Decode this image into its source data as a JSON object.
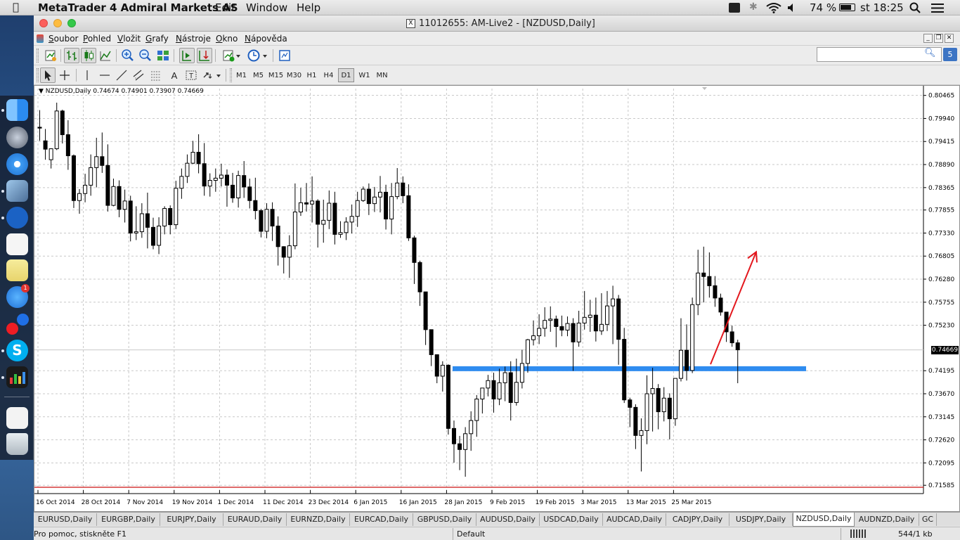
{
  "menubar": {
    "app_name": "MetaTrader 4 Admiral Markets AS",
    "items": [
      "Edit",
      "Window",
      "Help"
    ],
    "battery_text": "74 %",
    "clock": "st 18:25"
  },
  "window": {
    "title": "11012655: AM-Live2 - [NZDUSD,Daily]",
    "menu": [
      "Soubor",
      "Pohled",
      "Vložit",
      "Grafy",
      "Nástroje",
      "Okno",
      "Nápověda"
    ],
    "search_badge": "5"
  },
  "toolbar": {
    "timeframes": [
      "M1",
      "M5",
      "M15",
      "M30",
      "H1",
      "H4",
      "D1",
      "W1",
      "MN"
    ],
    "active_timeframe": "D1"
  },
  "chart_data": {
    "type": "candlestick",
    "symbol_label": "NZDUSD,Daily",
    "ohlc_text": "0.74674 0.74901 0.73907 0.74669",
    "current_price": "0.74669",
    "y_ticks": [
      "0.80465",
      "0.79940",
      "0.79415",
      "0.78890",
      "0.78365",
      "0.77855",
      "0.77330",
      "0.76805",
      "0.76280",
      "0.75755",
      "0.75230",
      "0.74195",
      "0.73670",
      "0.73145",
      "0.72620",
      "0.72095",
      "0.71585"
    ],
    "ylim": [
      0.7154,
      0.8062
    ],
    "x_labels": [
      "16 Oct 2014",
      "28 Oct 2014",
      "7 Nov 2014",
      "19 Nov 2014",
      "1 Dec 2014",
      "11 Dec 2014",
      "23 Dec 2014",
      "6 Jan 2015",
      "16 Jan 2015",
      "28 Jan 2015",
      "9 Feb 2015",
      "19 Feb 2015",
      "3 Mar 2015",
      "13 Mar 2015",
      "25 Mar 2015"
    ],
    "support_level": 0.7424,
    "support_range": [
      "28 Jan 2015",
      "15 Apr 2015"
    ],
    "arrow": {
      "from": [
        0.7434,
        "31 Mar 2015"
      ],
      "to": [
        0.769,
        "6 Apr 2015"
      ]
    },
    "colors": {
      "support": "#2f8cf0",
      "arrow": "#e3171d",
      "bottom_line": "#cc1111"
    },
    "grid": true,
    "candles": [
      [
        0.7974,
        0.8013,
        0.7972,
        0.7943
      ],
      [
        0.7943,
        0.797,
        0.7924,
        0.79
      ],
      [
        0.79,
        0.7926,
        0.7925,
        0.788
      ],
      [
        0.7925,
        0.803,
        0.8011,
        0.7922
      ],
      [
        0.8011,
        0.8014,
        0.7957,
        0.7937
      ],
      [
        0.7957,
        0.799,
        0.7909,
        0.7877
      ],
      [
        0.7909,
        0.7912,
        0.7807,
        0.779
      ],
      [
        0.7807,
        0.7833,
        0.7823,
        0.7777
      ],
      [
        0.7823,
        0.7868,
        0.7842,
        0.7803
      ],
      [
        0.7842,
        0.7912,
        0.7882,
        0.7818
      ],
      [
        0.7882,
        0.795,
        0.7907,
        0.7837
      ],
      [
        0.7907,
        0.7962,
        0.7887,
        0.787
      ],
      [
        0.7887,
        0.7935,
        0.7796,
        0.7782
      ],
      [
        0.7796,
        0.7857,
        0.7839,
        0.7794
      ],
      [
        0.7839,
        0.7853,
        0.7787,
        0.7769
      ],
      [
        0.7787,
        0.7832,
        0.7806,
        0.7757
      ],
      [
        0.7806,
        0.7818,
        0.7733,
        0.7714
      ],
      [
        0.7733,
        0.7794,
        0.7736,
        0.7717
      ],
      [
        0.7736,
        0.7801,
        0.7777,
        0.7722
      ],
      [
        0.7777,
        0.7825,
        0.7746,
        0.7698
      ],
      [
        0.7746,
        0.7768,
        0.7705,
        0.7696
      ],
      [
        0.7705,
        0.7769,
        0.7749,
        0.7685
      ],
      [
        0.7749,
        0.7794,
        0.7789,
        0.773
      ],
      [
        0.7789,
        0.7796,
        0.7752,
        0.773
      ],
      [
        0.7752,
        0.7852,
        0.7835,
        0.7742
      ],
      [
        0.7835,
        0.788,
        0.7862,
        0.7811
      ],
      [
        0.7862,
        0.7912,
        0.7892,
        0.7847
      ],
      [
        0.7892,
        0.7943,
        0.7917,
        0.789
      ],
      [
        0.7917,
        0.7958,
        0.7891,
        0.7869
      ],
      [
        0.7891,
        0.7938,
        0.784,
        0.7818
      ],
      [
        0.784,
        0.7869,
        0.7853,
        0.7816
      ],
      [
        0.7853,
        0.788,
        0.7858,
        0.7827
      ],
      [
        0.7858,
        0.7891,
        0.7865,
        0.7839
      ],
      [
        0.7865,
        0.7878,
        0.7842,
        0.7793
      ],
      [
        0.7842,
        0.787,
        0.7813,
        0.7802
      ],
      [
        0.7813,
        0.7875,
        0.7864,
        0.7791
      ],
      [
        0.7864,
        0.7897,
        0.7838,
        0.7813
      ],
      [
        0.7838,
        0.7857,
        0.7807,
        0.7789
      ],
      [
        0.7807,
        0.7859,
        0.7784,
        0.7764
      ],
      [
        0.7784,
        0.7788,
        0.7737,
        0.7723
      ],
      [
        0.7737,
        0.7801,
        0.7787,
        0.7721
      ],
      [
        0.7787,
        0.7803,
        0.7749,
        0.7715
      ],
      [
        0.7749,
        0.7771,
        0.7702,
        0.7659
      ],
      [
        0.7702,
        0.7703,
        0.7678,
        0.7641
      ],
      [
        0.7678,
        0.7728,
        0.7704,
        0.7631
      ],
      [
        0.7704,
        0.7846,
        0.7781,
        0.7696
      ],
      [
        0.7781,
        0.7836,
        0.7802,
        0.7772
      ],
      [
        0.7802,
        0.7847,
        0.7799,
        0.7782
      ],
      [
        0.7799,
        0.7862,
        0.7806,
        0.7757
      ],
      [
        0.7806,
        0.781,
        0.7753,
        0.77
      ],
      [
        0.7753,
        0.7809,
        0.7762,
        0.7711
      ],
      [
        0.7762,
        0.783,
        0.7801,
        0.7742
      ],
      [
        0.7801,
        0.7827,
        0.773,
        0.7707
      ],
      [
        0.773,
        0.776,
        0.7734,
        0.7722
      ],
      [
        0.7734,
        0.7769,
        0.7758,
        0.7717
      ],
      [
        0.7758,
        0.7798,
        0.7771,
        0.7732
      ],
      [
        0.7771,
        0.7827,
        0.7807,
        0.7747
      ],
      [
        0.7807,
        0.7839,
        0.7833,
        0.7804
      ],
      [
        0.7833,
        0.7846,
        0.78,
        0.7774
      ],
      [
        0.78,
        0.7838,
        0.7815,
        0.7781
      ],
      [
        0.7815,
        0.7863,
        0.7826,
        0.778
      ],
      [
        0.7826,
        0.7843,
        0.7765,
        0.7741
      ],
      [
        0.7765,
        0.7847,
        0.7816,
        0.773
      ],
      [
        0.7816,
        0.7881,
        0.7847,
        0.781
      ],
      [
        0.7847,
        0.7862,
        0.7818,
        0.7801
      ],
      [
        0.7818,
        0.7844,
        0.7722,
        0.7715
      ],
      [
        0.7722,
        0.7727,
        0.7666,
        0.7617
      ],
      [
        0.7666,
        0.767,
        0.7599,
        0.7567
      ],
      [
        0.7599,
        0.7591,
        0.7513,
        0.7478
      ],
      [
        0.7513,
        0.7477,
        0.7456,
        0.743
      ],
      [
        0.7456,
        0.7428,
        0.7407,
        0.7391
      ],
      [
        0.7407,
        0.7441,
        0.7432,
        0.7372
      ],
      [
        0.7432,
        0.7434,
        0.7288,
        0.7274
      ],
      [
        0.7288,
        0.7306,
        0.7253,
        0.721
      ],
      [
        0.7253,
        0.7271,
        0.724,
        0.7193
      ],
      [
        0.724,
        0.7291,
        0.7276,
        0.7178
      ],
      [
        0.7276,
        0.7327,
        0.7306,
        0.7237
      ],
      [
        0.7306,
        0.7364,
        0.7355,
        0.7269
      ],
      [
        0.7355,
        0.7376,
        0.738,
        0.7322
      ],
      [
        0.738,
        0.741,
        0.7397,
        0.7361
      ],
      [
        0.7397,
        0.7415,
        0.7355,
        0.7324
      ],
      [
        0.7355,
        0.7424,
        0.7392,
        0.7341
      ],
      [
        0.7392,
        0.7429,
        0.7415,
        0.735
      ],
      [
        0.7415,
        0.7441,
        0.7347,
        0.7306
      ],
      [
        0.7347,
        0.7447,
        0.7393,
        0.734
      ],
      [
        0.7393,
        0.7467,
        0.7436,
        0.7379
      ],
      [
        0.7436,
        0.7492,
        0.749,
        0.7415
      ],
      [
        0.749,
        0.7534,
        0.7499,
        0.7477
      ],
      [
        0.7499,
        0.7548,
        0.7516,
        0.748
      ],
      [
        0.7516,
        0.7564,
        0.7534,
        0.7497
      ],
      [
        0.7534,
        0.7566,
        0.7537,
        0.7508
      ],
      [
        0.7537,
        0.7545,
        0.752,
        0.7473
      ],
      [
        0.752,
        0.7545,
        0.7512,
        0.7498
      ],
      [
        0.7512,
        0.7543,
        0.7527,
        0.7498
      ],
      [
        0.7527,
        0.7539,
        0.7485,
        0.7419
      ],
      [
        0.7485,
        0.7556,
        0.7528,
        0.7474
      ],
      [
        0.7528,
        0.7601,
        0.7541,
        0.7513
      ],
      [
        0.7541,
        0.7581,
        0.7546,
        0.7508
      ],
      [
        0.7546,
        0.7586,
        0.751,
        0.7486
      ],
      [
        0.751,
        0.7596,
        0.7525,
        0.7501
      ],
      [
        0.7525,
        0.7601,
        0.7567,
        0.751
      ],
      [
        0.7567,
        0.7613,
        0.7583,
        0.748
      ],
      [
        0.7583,
        0.7592,
        0.7491,
        0.7433
      ],
      [
        0.7491,
        0.7517,
        0.7353,
        0.7346
      ],
      [
        0.7353,
        0.7358,
        0.7336,
        0.7291
      ],
      [
        0.7336,
        0.7343,
        0.7272,
        0.7241
      ],
      [
        0.7272,
        0.7311,
        0.7283,
        0.719
      ],
      [
        0.7283,
        0.7409,
        0.7367,
        0.7252
      ],
      [
        0.7367,
        0.7426,
        0.7379,
        0.7281
      ],
      [
        0.7379,
        0.7389,
        0.7326,
        0.7286
      ],
      [
        0.7326,
        0.7382,
        0.7357,
        0.7304
      ],
      [
        0.7357,
        0.7368,
        0.731,
        0.7263
      ],
      [
        0.731,
        0.7401,
        0.7402,
        0.7294
      ],
      [
        0.7402,
        0.7539,
        0.7466,
        0.7395
      ],
      [
        0.7466,
        0.7525,
        0.742,
        0.7397
      ],
      [
        0.742,
        0.7586,
        0.757,
        0.7414
      ],
      [
        0.757,
        0.7695,
        0.7642,
        0.7546
      ],
      [
        0.7642,
        0.7702,
        0.7634,
        0.7575
      ],
      [
        0.7634,
        0.7689,
        0.7613,
        0.7586
      ],
      [
        0.7613,
        0.7635,
        0.7585,
        0.7565
      ],
      [
        0.7585,
        0.7595,
        0.7553,
        0.7545
      ],
      [
        0.7553,
        0.7552,
        0.7508,
        0.7485
      ],
      [
        0.7508,
        0.7522,
        0.7483,
        0.7474
      ],
      [
        0.7483,
        0.749,
        0.7467,
        0.7391
      ]
    ]
  },
  "tabs": [
    "EURUSD,Daily",
    "EURGBP,Daily",
    "EURJPY,Daily",
    "EURAUD,Daily",
    "EURNZD,Daily",
    "EURCAD,Daily",
    "GBPUSD,Daily",
    "AUDUSD,Daily",
    "USDCAD,Daily",
    "AUDCAD,Daily",
    "CADJPY,Daily",
    "USDJPY,Daily",
    "NZDUSD,Daily",
    "AUDNZD,Daily",
    "GC"
  ],
  "active_tab": "NZDUSD,Daily",
  "status": {
    "help": "Pro pomoc, stiskněte F1",
    "profile": "Default",
    "traffic": "544/1 kb"
  }
}
